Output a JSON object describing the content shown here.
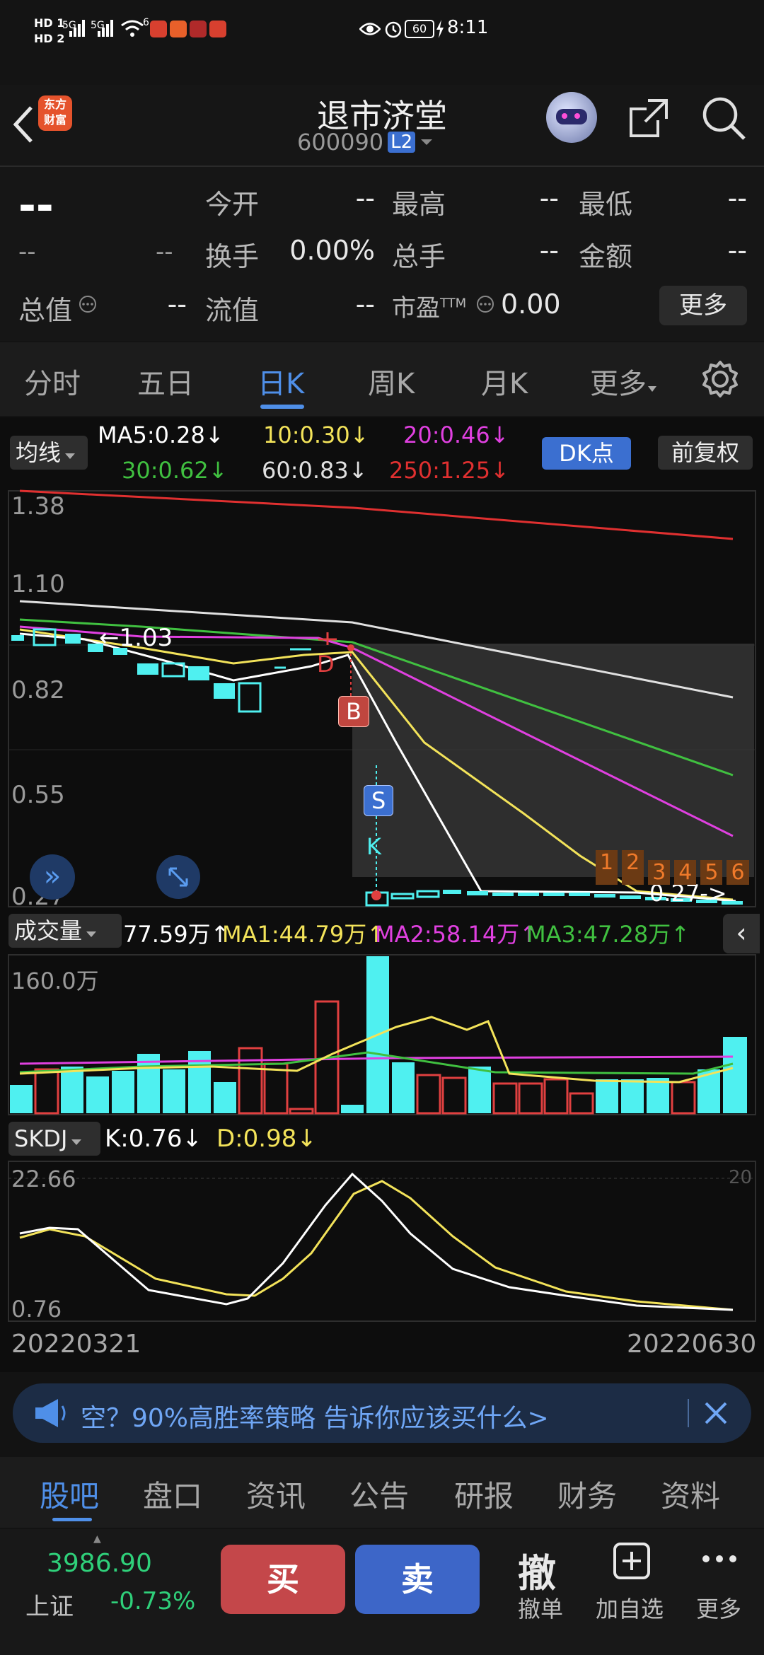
{
  "status_bar": {
    "sim1": "HD 1",
    "sim2": "HD 2",
    "net1": "5G",
    "net2": "5G",
    "wifi": "6",
    "battery": "60",
    "time": "8:11"
  },
  "header": {
    "logo_line1": "东方",
    "logo_line2": "财富",
    "title": "退市济堂",
    "code": "600090",
    "level_badge": "L2"
  },
  "quote": {
    "price": "--",
    "change": "--",
    "change_pct": "--",
    "open_label": "今开",
    "open": "--",
    "high_label": "最高",
    "high": "--",
    "low_label": "最低",
    "low": "--",
    "turnover_label": "换手",
    "turnover": "0.00%",
    "volume_label": "总手",
    "volume": "--",
    "amount_label": "金额",
    "amount": "--",
    "mktcap_label": "总值",
    "mktcap": "--",
    "float_label": "流值",
    "float_cap": "--",
    "pe_label": "市盈",
    "pe_sup": "TTM",
    "pe": "0.00",
    "more": "更多"
  },
  "tabs": [
    "分时",
    "五日",
    "日K",
    "周K",
    "月K",
    "更多"
  ],
  "ma_bar": {
    "selector": "均线",
    "ma5": "MA5:0.28↓",
    "ma10": "10:0.30↓",
    "ma20": "20:0.46↓",
    "ma30": "30:0.62↓",
    "ma60": "60:0.83↓",
    "ma250": "250:1.25↓",
    "dk_button": "DK点",
    "adjust_button": "前复权"
  },
  "kline": {
    "y_labels": [
      "1.38",
      "1.10",
      "0.82",
      "0.55",
      "0.27"
    ],
    "high_marker": "1.03",
    "low_marker": "0.27->",
    "signals": {
      "d": "D",
      "b": "B",
      "s": "S",
      "k": "K"
    },
    "numbers": [
      "1",
      "2",
      "3",
      "4",
      "5",
      "6"
    ]
  },
  "volume_bar": {
    "selector": "成交量",
    "vol": "77.59万↑",
    "ma1": "MA1:44.79万↑",
    "ma2": "MA2:58.14万↑",
    "ma3": "MA3:47.28万↑",
    "y_label": "160.0万"
  },
  "skdj_bar": {
    "selector": "SKDJ",
    "k": "K:0.76↓",
    "d": "D:0.98↓",
    "y_top": "22.66",
    "y_bottom": "0.76",
    "right_mark": "20"
  },
  "dates": {
    "start": "20220321",
    "end": "20220630"
  },
  "ad_banner": {
    "text": "空？90%高胜率策略 告诉你应该买什么>"
  },
  "bottom_tabs": [
    "股吧",
    "盘口",
    "资讯",
    "公告",
    "研报",
    "财务",
    "资料"
  ],
  "index": {
    "value": "3986.90",
    "name": "上证",
    "change": "-0.73%"
  },
  "actions": {
    "buy": "买",
    "sell": "卖",
    "cancel_glyph": "撤",
    "cancel_label": "撤单",
    "add_label": "加自选",
    "more_label": "更多"
  },
  "colors": {
    "up": "#e04040",
    "down": "#4ff0f0",
    "accent": "#4f8fe8",
    "ma5": "#ffffff",
    "ma10": "#f3e35a",
    "ma20": "#e040e0",
    "ma30": "#40c040",
    "ma60": "#e0e0e0",
    "ma250": "#e03030"
  }
}
